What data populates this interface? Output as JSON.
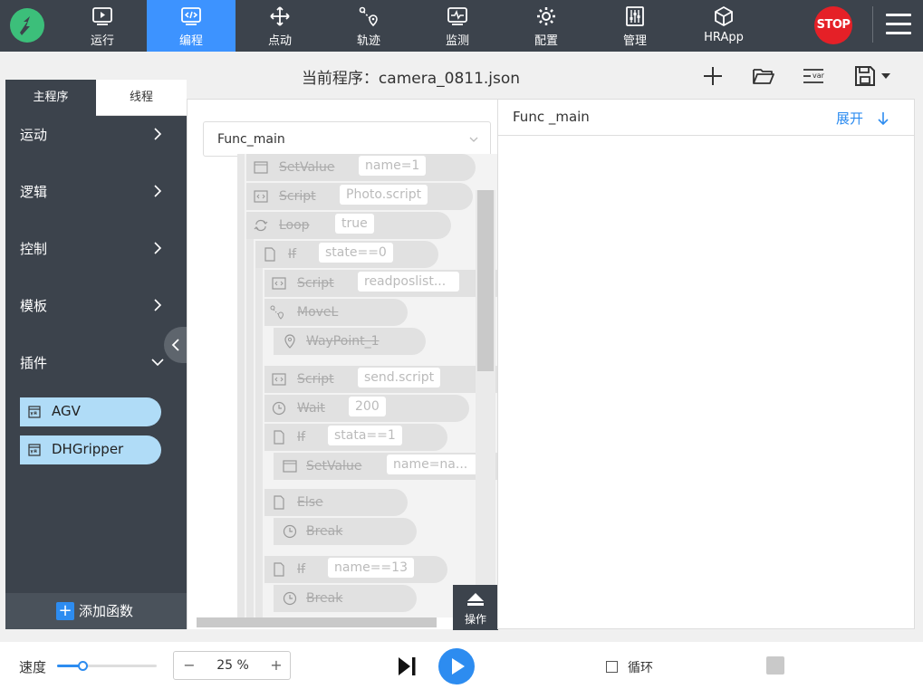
{
  "nav": {
    "items": [
      {
        "label": "运行",
        "icon": "play-icon"
      },
      {
        "label": "编程",
        "icon": "code-icon"
      },
      {
        "label": "点动",
        "icon": "move-icon"
      },
      {
        "label": "轨迹",
        "icon": "trajectory-icon"
      },
      {
        "label": "监测",
        "icon": "monitor-icon"
      },
      {
        "label": "配置",
        "icon": "config-gear-icon"
      },
      {
        "label": "管理",
        "icon": "manage-icon"
      },
      {
        "label": "HRApp",
        "icon": "cube-icon"
      }
    ],
    "active_index": 1,
    "stop_label": "STOP"
  },
  "titlebar": {
    "title": "当前程序：camera_0811.json"
  },
  "left": {
    "tabs": [
      "主程序",
      "线程"
    ],
    "categories": [
      "运动",
      "逻辑",
      "控制",
      "模板",
      "插件"
    ],
    "plugins": [
      "AGV",
      "DHGripper"
    ],
    "add_func_label": "添加函数"
  },
  "middle": {
    "func_select": "Func_main",
    "nodes": [
      {
        "name": "SetValue",
        "param": "name=1",
        "icon": "var-icon"
      },
      {
        "name": "Script",
        "param": "Photo.script",
        "icon": "script-icon"
      },
      {
        "name": "Loop",
        "param": "true",
        "icon": "loop-icon"
      },
      {
        "name": "If",
        "param": "state==0",
        "icon": "file-icon"
      },
      {
        "name": "Script",
        "param": "readposlist...",
        "icon": "script-icon"
      },
      {
        "name": "MoveL",
        "param": "",
        "icon": "movel-icon"
      },
      {
        "name": "WayPoint_1",
        "param": "",
        "icon": "waypoint-icon"
      },
      {
        "name": "Script",
        "param": "send.script",
        "icon": "script-icon"
      },
      {
        "name": "Wait",
        "param": "200",
        "icon": "clock-icon"
      },
      {
        "name": "If",
        "param": "stata==1",
        "icon": "file-icon"
      },
      {
        "name": "SetValue",
        "param": "name=na...",
        "icon": "var-icon"
      },
      {
        "name": "Else",
        "param": "",
        "icon": "file-icon"
      },
      {
        "name": "Break",
        "param": "",
        "icon": "clock-icon"
      },
      {
        "name": "If",
        "param": "name==13",
        "icon": "file-icon"
      },
      {
        "name": "Break",
        "param": "",
        "icon": "clock-icon"
      }
    ],
    "op_label": "操作"
  },
  "right": {
    "title": "Func _main",
    "expand_label": "展开"
  },
  "bottom": {
    "speed_label": "速度",
    "speed_value": "25 %",
    "speed_fraction": 0.25,
    "minus": "−",
    "plus": "+",
    "loop_label": "循环"
  },
  "colors": {
    "topbar": "#3c434c",
    "accent": "#3d93ff",
    "stop": "#e52027",
    "plugin_bg": "#b0dcf7"
  }
}
